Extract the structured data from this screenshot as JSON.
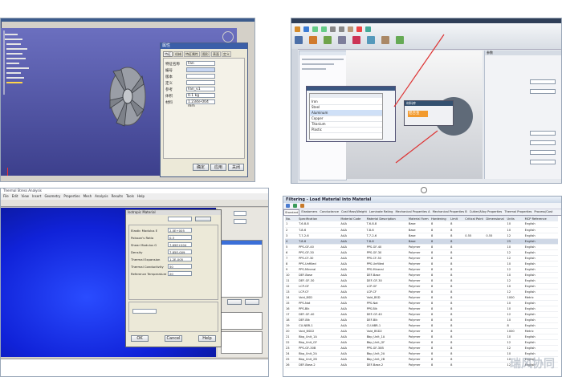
{
  "q1": {
    "dialog_title": "属性",
    "tabs": [
      "特征",
      "机械",
      "特征属性",
      "图形",
      "表面",
      "定义"
    ],
    "fields": [
      {
        "label": "特征名称",
        "value": "Fan"
      },
      {
        "label": "编号"
      },
      {
        "label": "版本"
      },
      {
        "label": "定义"
      },
      {
        "label": "参考",
        "value": "Fan_v1"
      },
      {
        "label": "体积",
        "value": "0.1 kg"
      },
      {
        "label": "材料",
        "value": "1.234e-004 mm"
      }
    ],
    "buttons": [
      "确定",
      "应用",
      "关闭"
    ]
  },
  "q2": {
    "tab_title": "模型管理",
    "popup_title": "材料库",
    "popup_value": "铝合金",
    "list_rows": [
      "Item",
      "Iron",
      "Steel",
      "Aluminum",
      "Copper",
      "Titanium",
      "Plastic"
    ],
    "side_label": "参数"
  },
  "q3": {
    "title": "Thermal Stress Analysis",
    "menu": [
      "File",
      "Edit",
      "View",
      "Insert",
      "Geometry",
      "Properties",
      "Mesh",
      "Analysis",
      "Results",
      "Tools",
      "Help"
    ],
    "dialog_title": "Isotropic Material",
    "fields": [
      {
        "label": "Elastic Modulus E",
        "value": "2.0E+005"
      },
      {
        "label": "Poisson's Ratio",
        "value": "0.3"
      },
      {
        "label": "Shear Modulus G",
        "value": "7.69E+004"
      },
      {
        "label": "Density",
        "value": "7.85E-009"
      },
      {
        "label": "Thermal Expansion",
        "value": "1.2E-005"
      },
      {
        "label": "Thermal Conductivity",
        "value": "50"
      },
      {
        "label": "Reference Temperature",
        "value": "20"
      }
    ],
    "buttons": [
      "OK",
      "Cancel",
      "Help"
    ]
  },
  "q4": {
    "title": "Filtering - Load Material into Material",
    "tabs": [
      "Standard",
      "Elastomers",
      "Conductance",
      "Cost Mass/Weight",
      "Laminate Rating",
      "Mechanical Properties A",
      "Mechanical Properties B",
      "Cutter/Alloy Properties",
      "Thermal Properties",
      "Process/Cost"
    ],
    "columns": [
      "No.",
      "Specification",
      "Material Code",
      "Material Description",
      "Material Form",
      "Hardening",
      "Limit",
      "Critical Point",
      "Dimensional",
      "Units",
      "MCP Reference"
    ],
    "rows": [
      [
        "1",
        "T-6-8-8",
        "AAA",
        "T-6-8-8",
        "Base",
        "8",
        "8",
        "",
        "",
        "10",
        "English"
      ],
      [
        "2",
        "T-8-6",
        "AAA",
        "T-8-6",
        "Base",
        "8",
        "8",
        "",
        "",
        "10",
        "English"
      ],
      [
        "3",
        "T-7-2-6",
        "AAA",
        "T-7-2-6",
        "Base",
        "8",
        "8",
        "0.55",
        "0.55",
        "12",
        "English"
      ],
      [
        "4",
        "T-8-6",
        "AAA",
        "T-8-6",
        "Base",
        "8",
        "8",
        "",
        "",
        "25",
        "English"
      ],
      [
        "5",
        "PPS-GF-40",
        "AAA",
        "PPS-GF-40",
        "Polymer",
        "8",
        "8",
        "",
        "",
        "10",
        "English"
      ],
      [
        "6",
        "PPS-GF-30",
        "AAA",
        "PPS-GF-30",
        "Polymer",
        "8",
        "8",
        "",
        "",
        "12",
        "English"
      ],
      [
        "7",
        "PPS-CF-30",
        "AAA",
        "PPS-CF-30",
        "Polymer",
        "8",
        "8",
        "",
        "",
        "12",
        "English"
      ],
      [
        "8",
        "PPS-Unfilled",
        "AAA",
        "PPS-Unfilled",
        "Polymer",
        "8",
        "8",
        "",
        "",
        "10",
        "English"
      ],
      [
        "9",
        "PPS-Mineral",
        "AAA",
        "PPS-Mineral",
        "Polymer",
        "8",
        "8",
        "",
        "",
        "12",
        "English"
      ],
      [
        "10",
        "DEF-Base",
        "AAA",
        "DEF-Base",
        "Polymer",
        "8",
        "8",
        "",
        "",
        "10",
        "English"
      ],
      [
        "11",
        "DEF-GF-30",
        "AAA",
        "DEF-GF-30",
        "Polymer",
        "8",
        "8",
        "",
        "",
        "12",
        "English"
      ],
      [
        "12",
        "LCP-GF",
        "AAA",
        "LCP-GF",
        "Polymer",
        "8",
        "8",
        "",
        "",
        "10",
        "English"
      ],
      [
        "13",
        "LCP-CF",
        "AAA",
        "LCP-CF",
        "Polymer",
        "8",
        "8",
        "",
        "",
        "12",
        "English"
      ],
      [
        "14",
        "Void_BSD",
        "AAA",
        "Void_BSD",
        "Polymer",
        "8",
        "8",
        "",
        "",
        "1000",
        "Metric"
      ],
      [
        "15",
        "PPS-Nat",
        "AAA",
        "PPS-Nat",
        "Polymer",
        "8",
        "8",
        "",
        "",
        "10",
        "English"
      ],
      [
        "16",
        "PPS-Blk",
        "AAA",
        "PPS-Blk",
        "Polymer",
        "8",
        "8",
        "",
        "",
        "10",
        "English"
      ],
      [
        "17",
        "DEF-GF-40",
        "AAA",
        "DEF-GF-40",
        "Polymer",
        "8",
        "8",
        "",
        "",
        "12",
        "English"
      ],
      [
        "18",
        "DEF-Blk",
        "AAA",
        "DEF-Blk",
        "Polymer",
        "8",
        "8",
        "",
        "",
        "10",
        "English"
      ],
      [
        "19",
        "CU-NBR-1",
        "AAA",
        "CU-NBR-1",
        "Polymer",
        "8",
        "8",
        "",
        "",
        "8",
        "English"
      ],
      [
        "20",
        "Void_BSD2",
        "AAA",
        "Void_BSD2",
        "Polymer",
        "8",
        "8",
        "",
        "",
        "1000",
        "Metric"
      ],
      [
        "21",
        "Bbp_Unit_1A",
        "AAA",
        "Bbp_Unit_1A",
        "Polymer",
        "8",
        "8",
        "",
        "",
        "10",
        "English"
      ],
      [
        "22",
        "Bbp_Unit_GF",
        "AAA",
        "Bbp_Unit_GF",
        "Polymer",
        "8",
        "8",
        "",
        "",
        "12",
        "English"
      ],
      [
        "23",
        "PPS-GF-30B",
        "AAA",
        "PPS-GF-30B",
        "Polymer",
        "8",
        "8",
        "",
        "",
        "12",
        "English"
      ],
      [
        "24",
        "Bbp_Unit_2A",
        "AAA",
        "Bbp_Unit_2A",
        "Polymer",
        "8",
        "8",
        "",
        "",
        "10",
        "English"
      ],
      [
        "25",
        "Bbp_Unit_2B",
        "AAA",
        "Bbp_Unit_2B",
        "Polymer",
        "8",
        "8",
        "",
        "",
        "10",
        "English"
      ],
      [
        "26",
        "DEF-Base-2",
        "AAA",
        "DEF-Base-2",
        "Polymer",
        "8",
        "8",
        "",
        "",
        "12",
        "English"
      ]
    ],
    "watermark": "瑞风协同"
  }
}
